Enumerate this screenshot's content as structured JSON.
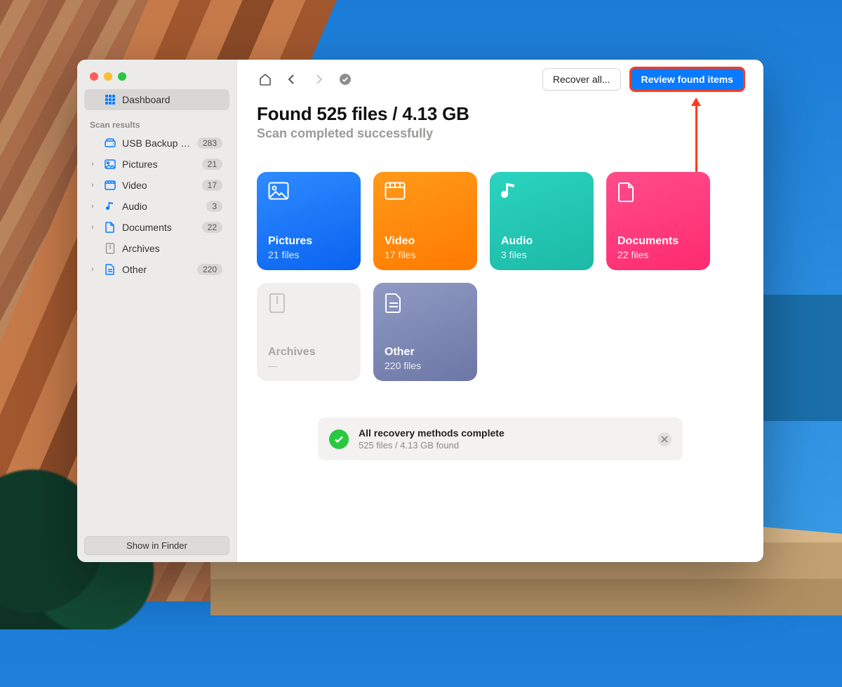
{
  "sidebar": {
    "dashboard_label": "Dashboard",
    "section_title": "Scan results",
    "items": [
      {
        "label": "USB Backup Ima…",
        "count": "283",
        "icon": "disk",
        "chevron": false,
        "dim": false
      },
      {
        "label": "Pictures",
        "count": "21",
        "icon": "image",
        "chevron": true,
        "dim": false
      },
      {
        "label": "Video",
        "count": "17",
        "icon": "film",
        "chevron": true,
        "dim": false
      },
      {
        "label": "Audio",
        "count": "3",
        "icon": "note",
        "chevron": true,
        "dim": false
      },
      {
        "label": "Documents",
        "count": "22",
        "icon": "doc",
        "chevron": true,
        "dim": false
      },
      {
        "label": "Archives",
        "count": "",
        "icon": "archive",
        "chevron": false,
        "dim": true
      },
      {
        "label": "Other",
        "count": "220",
        "icon": "other",
        "chevron": true,
        "dim": false
      }
    ],
    "footer_button": "Show in Finder"
  },
  "toolbar": {
    "recover_all_label": "Recover all...",
    "review_label": "Review found items"
  },
  "headline": {
    "title": "Found 525 files / 4.13 GB",
    "subtitle": "Scan completed successfully"
  },
  "cards": [
    {
      "key": "pictures",
      "title": "Pictures",
      "sub": "21 files"
    },
    {
      "key": "video",
      "title": "Video",
      "sub": "17 files"
    },
    {
      "key": "audio",
      "title": "Audio",
      "sub": "3 files"
    },
    {
      "key": "documents",
      "title": "Documents",
      "sub": "22 files"
    },
    {
      "key": "archives",
      "title": "Archives",
      "sub": "—"
    },
    {
      "key": "other",
      "title": "Other",
      "sub": "220 files"
    }
  ],
  "status": {
    "title": "All recovery methods complete",
    "subtitle": "525 files / 4.13 GB found"
  }
}
